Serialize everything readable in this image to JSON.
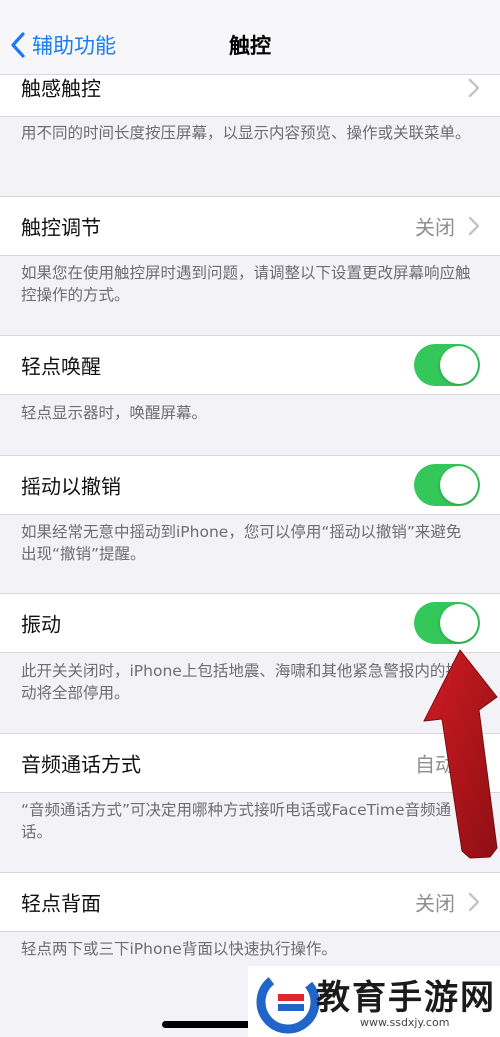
{
  "header": {
    "back_label": "辅助功能",
    "title": "触控"
  },
  "sections": [
    {
      "label": "触感触控",
      "control": "chevron",
      "footer": "用不同的时间长度按压屏幕，以显示内容预览、操作或关联菜单。"
    },
    {
      "label": "触控调节",
      "control": "chevron",
      "value": "关闭",
      "footer": "如果您在使用触控屏时遇到问题，请调整以下设置更改屏幕响应触控操作的方式。"
    },
    {
      "label": "轻点唤醒",
      "control": "toggle",
      "state": "on",
      "footer": "轻点显示器时，唤醒屏幕。"
    },
    {
      "label": "摇动以撤销",
      "control": "toggle",
      "state": "on",
      "footer": "如果经常无意中摇动到iPhone，您可以停用“摇动以撤销”来避免出现“撤销”提醒。"
    },
    {
      "label": "振动",
      "control": "toggle",
      "state": "on",
      "footer": "此开关关闭时，iPhone上包括地震、海啸和其他紧急警报内的振动将全部停用。"
    },
    {
      "label": "音频通话方式",
      "control": "chevron",
      "value": "自动",
      "footer": "“音频通话方式”可决定用哪种方式接听电话或FaceTime音频通话。"
    },
    {
      "label": "轻点背面",
      "control": "chevron",
      "value": "关闭",
      "footer": "轻点两下或三下iPhone背面以快速执行操作。"
    }
  ],
  "colors": {
    "accent": "#1a7bf2",
    "toggle_on": "#34c759",
    "annotation_arrow": "#b3141c"
  },
  "watermark": {
    "title": "教育手游网",
    "url": "www.ssdxjy.com"
  }
}
